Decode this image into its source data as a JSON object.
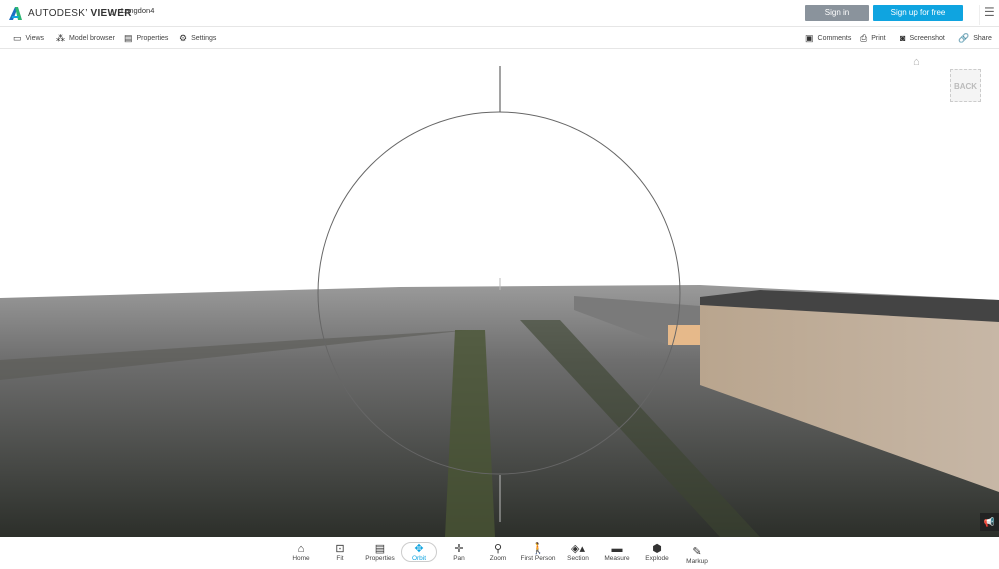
{
  "header": {
    "brand_prefix": "AUTODESK",
    "brand_suffix": "VIEWER",
    "breadcrumb": "Langdon4",
    "sign_in": "Sign in",
    "sign_up": "Sign up for free"
  },
  "toolbar": {
    "left": [
      {
        "label": "Views",
        "icon": "monitor-icon"
      },
      {
        "label": "Model browser",
        "icon": "hierarchy-icon"
      },
      {
        "label": "Properties",
        "icon": "properties-icon"
      },
      {
        "label": "Settings",
        "icon": "gear-icon"
      }
    ],
    "right": [
      {
        "label": "Comments",
        "icon": "comment-icon"
      },
      {
        "label": "Print",
        "icon": "printer-icon"
      },
      {
        "label": "Screenshot",
        "icon": "camera-icon"
      },
      {
        "label": "Share",
        "icon": "link-icon"
      }
    ]
  },
  "viewcube": {
    "back_label": "BACK"
  },
  "tools": [
    {
      "label": "Home"
    },
    {
      "label": "Fit"
    },
    {
      "label": "Properties"
    },
    {
      "label": "Orbit",
      "active": true
    },
    {
      "label": "Pan"
    },
    {
      "label": "Zoom"
    },
    {
      "label": "First Person"
    },
    {
      "label": "Section"
    },
    {
      "label": "Measure"
    },
    {
      "label": "Explode"
    },
    {
      "label": "Markup"
    }
  ],
  "colors": {
    "accent": "#0fa4e0",
    "signin": "#8a939c"
  }
}
